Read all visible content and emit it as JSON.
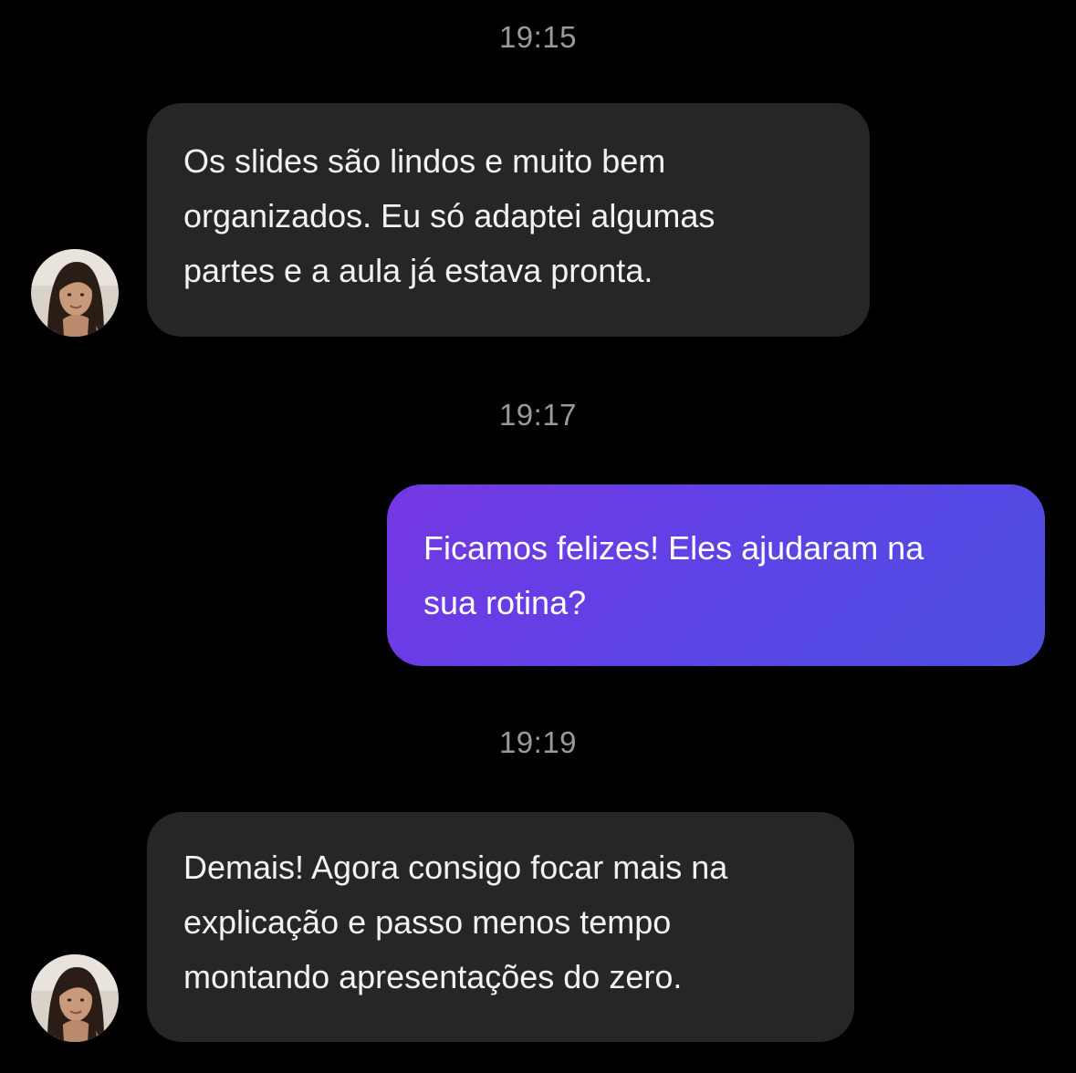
{
  "conversation": {
    "messages": [
      {
        "timestamp": "19:15",
        "sender": "incoming",
        "lines": [
          "Os slides são lindos e muito bem",
          "organizados. Eu só adaptei algumas",
          "partes e a aula já estava pronta."
        ]
      },
      {
        "timestamp": "19:17",
        "sender": "outgoing",
        "lines": [
          "Ficamos felizes! Eles ajudaram na",
          "sua rotina?"
        ]
      },
      {
        "timestamp": "19:19",
        "sender": "incoming",
        "lines": [
          "Demais! Agora consigo focar mais na",
          "explicação e passo menos tempo",
          "montando apresentações do zero."
        ]
      }
    ]
  },
  "colors": {
    "background": "#000000",
    "incoming_bubble": "#262628",
    "outgoing_bubble_start": "#7537e3",
    "outgoing_bubble_end": "#4c4fe0",
    "timestamp": "#9a9a9e"
  },
  "icons": {
    "avatar": "contact-avatar-photo"
  }
}
